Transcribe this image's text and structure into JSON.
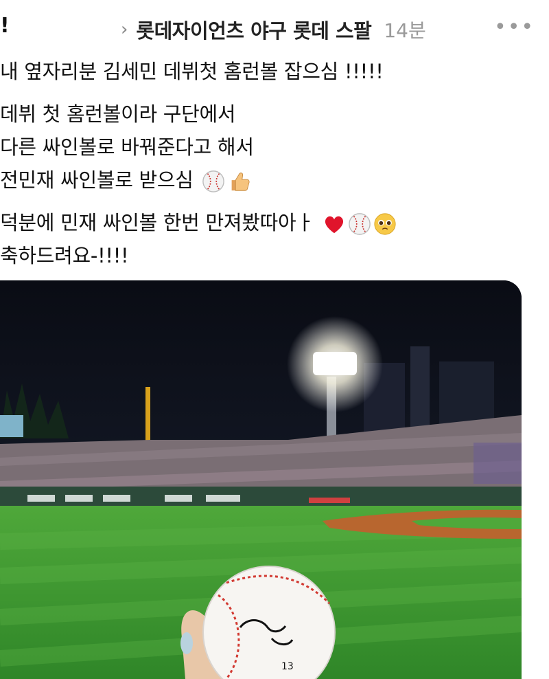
{
  "header": {
    "truncated_prefix": "!",
    "chevron": "›",
    "board_name": "롯데자이언츠 야구 롯데 스팔",
    "timestamp": "14분",
    "more_icon": "more-horizontal-icon"
  },
  "post": {
    "lines": [
      "내 옆자리분 김세민 데뷔첫 홈런볼 잡으심 !!!!!",
      "데뷔 첫 홈런볼이라 구단에서",
      "다른 싸인볼로 바꿔준다고 해서",
      "전민재 싸인볼로 받으심",
      "덕분에 민재 싸인볼 한번 만져봤따아ㅏ",
      "축하드려요-!!!!"
    ],
    "emojis": {
      "line4": [
        "baseball-emoji",
        "thumbs-up-emoji"
      ],
      "line5": [
        "heart-emoji",
        "baseball-emoji",
        "pleading-face-emoji"
      ]
    }
  },
  "photo": {
    "description_icon": "stadium-photo",
    "ball_signature_number": "13"
  },
  "colors": {
    "text": "#111111",
    "muted": "#9a9a9a",
    "heart": "#e0142b",
    "field": "#3f9a2e"
  }
}
